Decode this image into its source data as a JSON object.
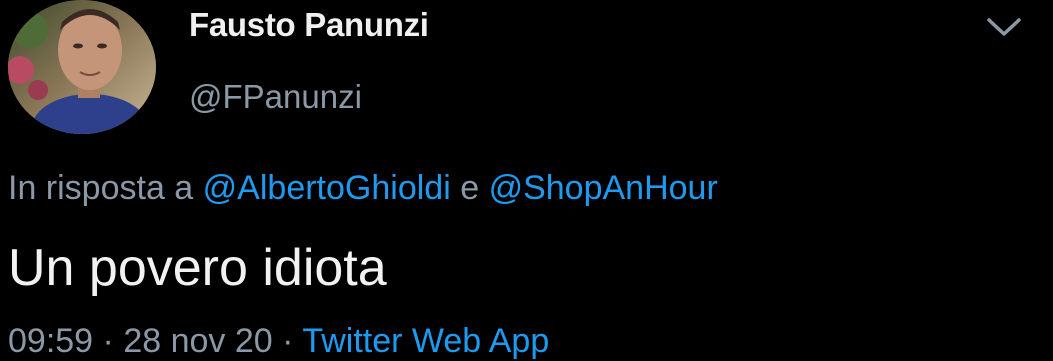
{
  "author": {
    "display_name": "Fausto Panunzi",
    "handle": "@FPanunzi"
  },
  "reply_context": {
    "prefix": "In risposta a",
    "mention_1": "@AlbertoGhioldi",
    "conjunction": "e",
    "mention_2": "@ShopAnHour"
  },
  "tweet": {
    "text": "Un povero idiota"
  },
  "meta": {
    "time": "09:59",
    "separator": "·",
    "date": "28 nov 20",
    "source": "Twitter Web App"
  },
  "icons": {
    "more": "chevron-down-icon"
  },
  "colors": {
    "background": "#000000",
    "primary_text": "#f0f0f0",
    "secondary_text": "#8b98a5",
    "link": "#1d9bf0"
  }
}
